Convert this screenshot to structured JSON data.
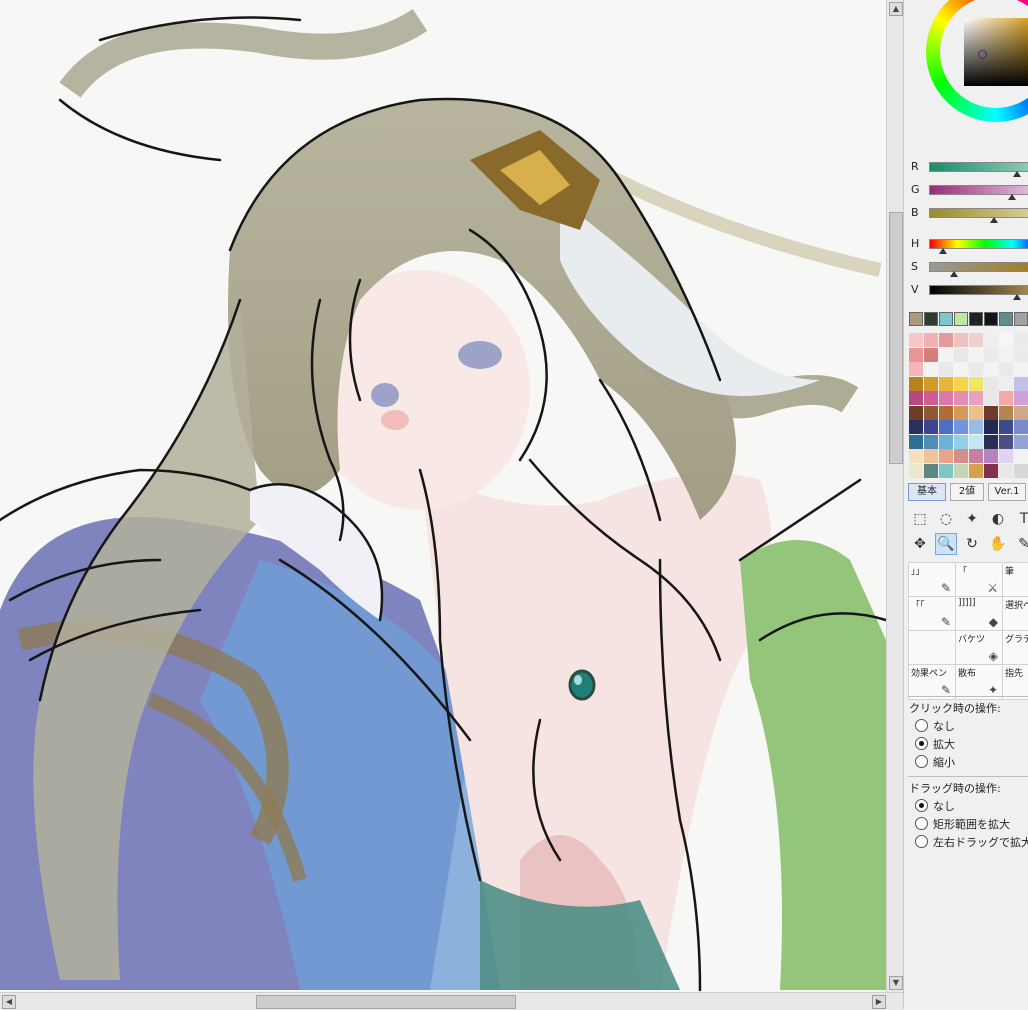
{
  "color_panel": {
    "sliders": [
      {
        "label": "R",
        "colors": [
          "#1a8c6a",
          "#9ad0c0"
        ],
        "value": 0.88
      },
      {
        "label": "G",
        "colors": [
          "#9b2a78",
          "#e5cce0"
        ],
        "value": 0.83
      },
      {
        "label": "B",
        "colors": [
          "#9a8a2a",
          "#ddd6a0"
        ],
        "value": 0.65
      },
      {
        "label": "H",
        "colors": [
          "#ff0000",
          "#ffff00",
          "#00ff00",
          "#00ffff",
          "#0000ff"
        ],
        "value": 0.14
      },
      {
        "label": "S",
        "colors": [
          "#999999",
          "#a27c19"
        ],
        "value": 0.25
      },
      {
        "label": "V",
        "colors": [
          "#000000",
          "#b29a5a"
        ],
        "value": 0.88
      }
    ],
    "current_colors": [
      "#a89a7a",
      "#2e3a32",
      "#7fc6cc",
      "#bde8a3",
      "#1e2226",
      "#141414",
      "#5f8c8c",
      "#9fa3a6"
    ],
    "swatches": [
      [
        "#f7c8c8",
        "#f3b1b1",
        "#e39a9a",
        "#f1c0c0",
        "#eed0d0",
        "#eeeeee",
        "#f6f6f6",
        "#eaeaea"
      ],
      [
        "#e79595",
        "#d47e7e",
        "#f3f3f3",
        "#e8e8e8",
        "#f3f3f3",
        "#ebebeb",
        "#f3f3f3",
        "#ebebeb"
      ],
      [
        "#f2b7b7",
        "#f3f3f3",
        "#e9e9e9",
        "#f3f3f3",
        "#eaeaea",
        "#f3f3f3",
        "#eaeaea",
        "#f3f3f3"
      ],
      [
        "#b5831d",
        "#d29b27",
        "#e8b43c",
        "#f4d648",
        "#f0e765",
        "#e8e8e8",
        "#eeeeee",
        "#c0c0e8"
      ],
      [
        "#b7497e",
        "#cf5c93",
        "#dc77a8",
        "#e38db6",
        "#eb9fc2",
        "#e8e8e8",
        "#f4a9a9",
        "#d2a0d8"
      ],
      [
        "#6d3e25",
        "#8e5833",
        "#b06c37",
        "#d49b55",
        "#ebc089",
        "#6e3a2b",
        "#b4854f",
        "#cfa78a"
      ],
      [
        "#2d2f5f",
        "#3d4590",
        "#506ec0",
        "#6f96dc",
        "#9abbe6",
        "#1e2a52",
        "#3a4b8e",
        "#7a8cc8"
      ],
      [
        "#2f6f93",
        "#4f8db2",
        "#6ab2d6",
        "#94cfe8",
        "#c4e8f3",
        "#2c2c54",
        "#4e4e86",
        "#97a3d3"
      ],
      [
        "#f6e1bf",
        "#f0c49b",
        "#e6a48b",
        "#d58c8b",
        "#c87fa0",
        "#b383c3",
        "#e1d4f0",
        "#f2f2f2"
      ],
      [
        "#ece8d0",
        "#5c8680",
        "#7fc6c6",
        "#c3d6b6",
        "#d5a24c",
        "#86304f",
        "#e8e8e8",
        "#d8d8d8"
      ]
    ],
    "tabs": [
      "基本",
      "2値",
      "Ver.1"
    ]
  },
  "tools": {
    "row1": [
      {
        "name": "rect-select-tool",
        "glyph": "⬚"
      },
      {
        "name": "lasso-tool",
        "glyph": "◌"
      },
      {
        "name": "magic-wand-tool",
        "glyph": "✦"
      },
      {
        "name": "shape-tool",
        "glyph": "◐"
      },
      {
        "name": "text-tool",
        "glyph": "T"
      }
    ],
    "row2": [
      {
        "name": "move-tool",
        "glyph": "✥"
      },
      {
        "name": "zoom-tool",
        "glyph": "🔍",
        "active": true
      },
      {
        "name": "rotate-tool",
        "glyph": "↻"
      },
      {
        "name": "hand-tool",
        "glyph": "✋"
      },
      {
        "name": "eyedropper-tool",
        "glyph": "✎"
      }
    ]
  },
  "brushes": [
    {
      "label": "」」",
      "icon": "✎"
    },
    {
      "label": "「",
      "icon": "⚔"
    },
    {
      "label": "筆",
      "icon": "✎"
    },
    {
      "label": "「「",
      "icon": "✎"
    },
    {
      "label": "]]]]]",
      "icon": "◆"
    },
    {
      "label": "選択ペ",
      "icon": "✎"
    },
    {
      "label": "",
      "icon": ""
    },
    {
      "label": "バケツ",
      "icon": "◈"
    },
    {
      "label": "グラデーション",
      "icon": "■"
    },
    {
      "label": "効果ペン",
      "icon": "✎"
    },
    {
      "label": "散布",
      "icon": "✦"
    },
    {
      "label": "指先",
      "icon": "☝"
    }
  ],
  "zoom_options": {
    "click_title": "クリック時の操作:",
    "click_options": [
      {
        "label": "なし",
        "checked": false
      },
      {
        "label": "拡大",
        "checked": true
      },
      {
        "label": "縮小",
        "checked": false
      }
    ],
    "drag_title": "ドラッグ時の操作:",
    "drag_options": [
      {
        "label": "なし",
        "checked": true
      },
      {
        "label": "矩形範囲を拡大",
        "checked": false
      },
      {
        "label": "左右ドラッグで拡大縮小",
        "checked": false
      }
    ]
  },
  "scroll": {
    "up": "▲",
    "down": "▼",
    "left": "◀",
    "right": "▶"
  }
}
